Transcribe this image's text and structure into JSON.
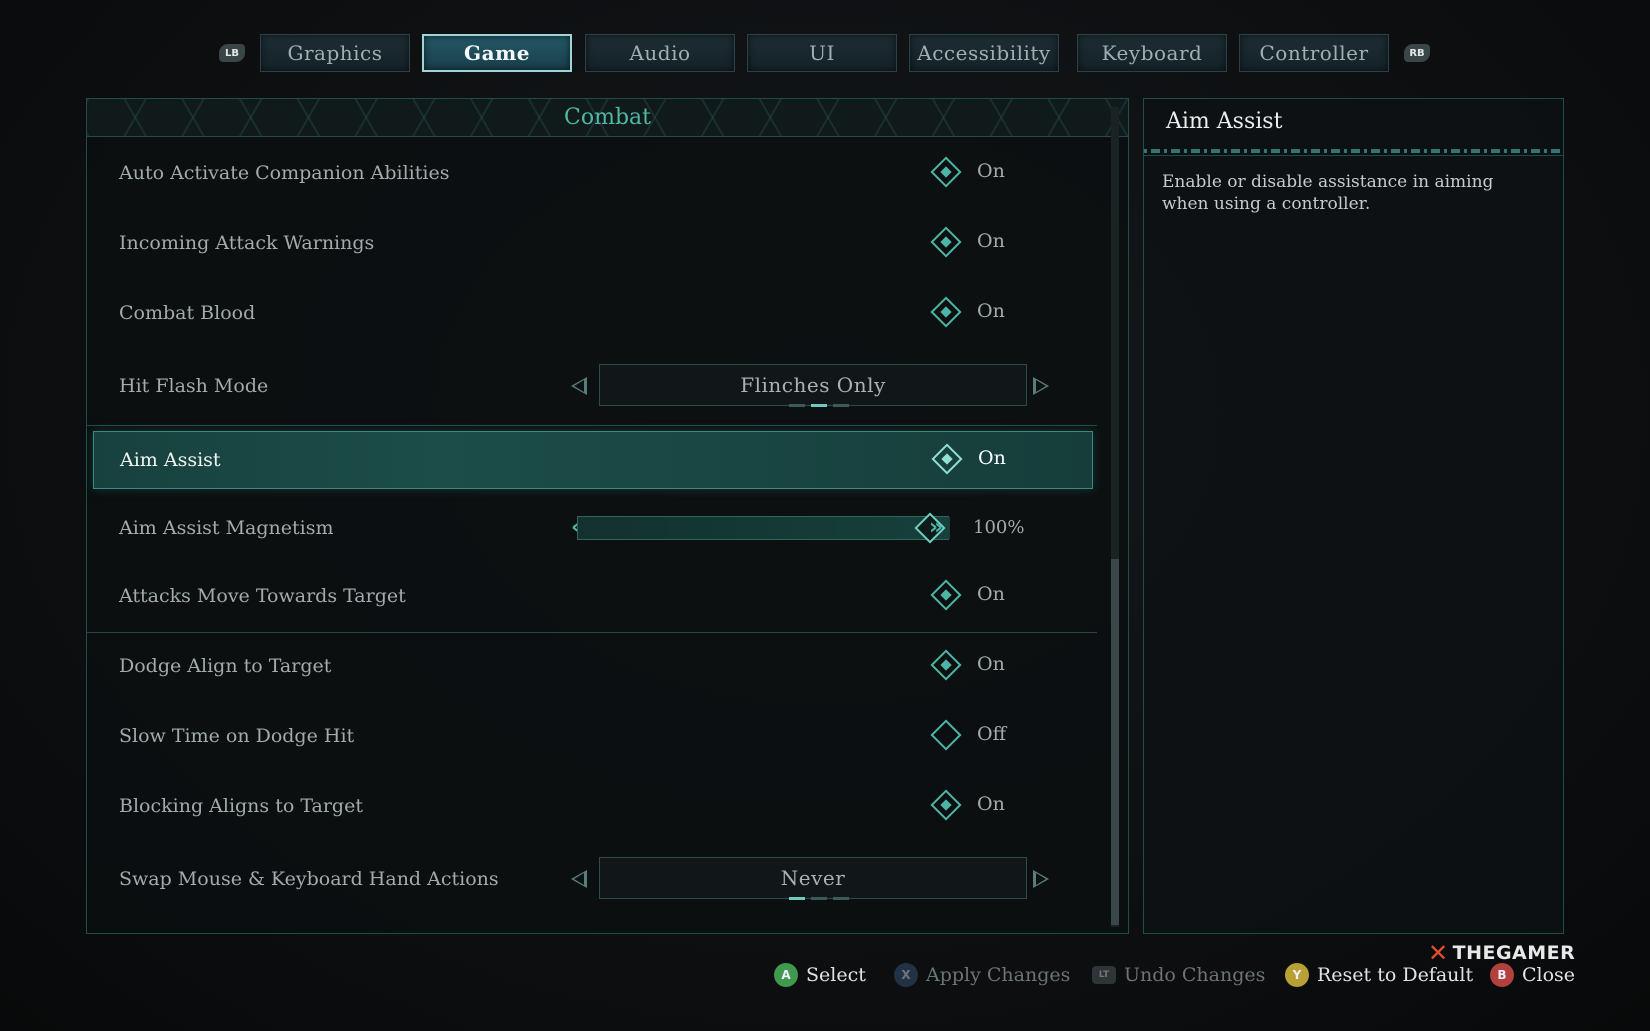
{
  "tabs": {
    "left_bumper": "LB",
    "right_bumper": "RB",
    "items": [
      {
        "label": "Graphics"
      },
      {
        "label": "Game"
      },
      {
        "label": "Audio"
      },
      {
        "label": "UI"
      },
      {
        "label": "Accessibility"
      },
      {
        "label": "Keyboard"
      },
      {
        "label": "Controller"
      }
    ],
    "active": "Game"
  },
  "section": {
    "title": "Combat"
  },
  "settings": [
    {
      "label": "Auto Activate Companion Abilities",
      "type": "toggle",
      "value": "On"
    },
    {
      "label": "Incoming Attack Warnings",
      "type": "toggle",
      "value": "On"
    },
    {
      "label": "Combat Blood",
      "type": "toggle",
      "value": "On"
    },
    {
      "label": "Hit Flash Mode",
      "type": "cycler",
      "value": "Flinches Only",
      "option_index": 1,
      "option_count": 3
    },
    {
      "label": "Aim Assist",
      "type": "toggle",
      "value": "On",
      "selected": true
    },
    {
      "label": "Aim Assist Magnetism",
      "type": "slider",
      "value": "100%",
      "fraction": 1.0
    },
    {
      "label": "Attacks Move Towards Target",
      "type": "toggle",
      "value": "On"
    },
    {
      "label": "Dodge Align to Target",
      "type": "toggle",
      "value": "On"
    },
    {
      "label": "Slow Time on Dodge Hit",
      "type": "toggle",
      "value": "Off"
    },
    {
      "label": "Blocking Aligns to Target",
      "type": "toggle",
      "value": "On"
    },
    {
      "label": "Swap Mouse & Keyboard Hand Actions",
      "type": "cycler",
      "value": "Never",
      "option_index": 0,
      "option_count": 3
    }
  ],
  "description": {
    "title": "Aim Assist",
    "text": "Enable or disable assistance in aiming when using a controller."
  },
  "footer": {
    "select": {
      "glyph": "A",
      "label": "Select"
    },
    "apply": {
      "glyph": "X",
      "label": "Apply Changes"
    },
    "undo": {
      "glyph": "LT",
      "label": "Undo Changes"
    },
    "reset": {
      "glyph": "Y",
      "label": "Reset to Default"
    },
    "close": {
      "glyph": "B",
      "label": "Close"
    }
  },
  "watermark": "THEGAMER",
  "colors": {
    "accent": "#4db5a5",
    "selected_row": "#1c4d49",
    "button_a": "#3f9a4e",
    "button_x": "#3c5e86",
    "button_y": "#b8a035",
    "button_b": "#b2413d"
  }
}
